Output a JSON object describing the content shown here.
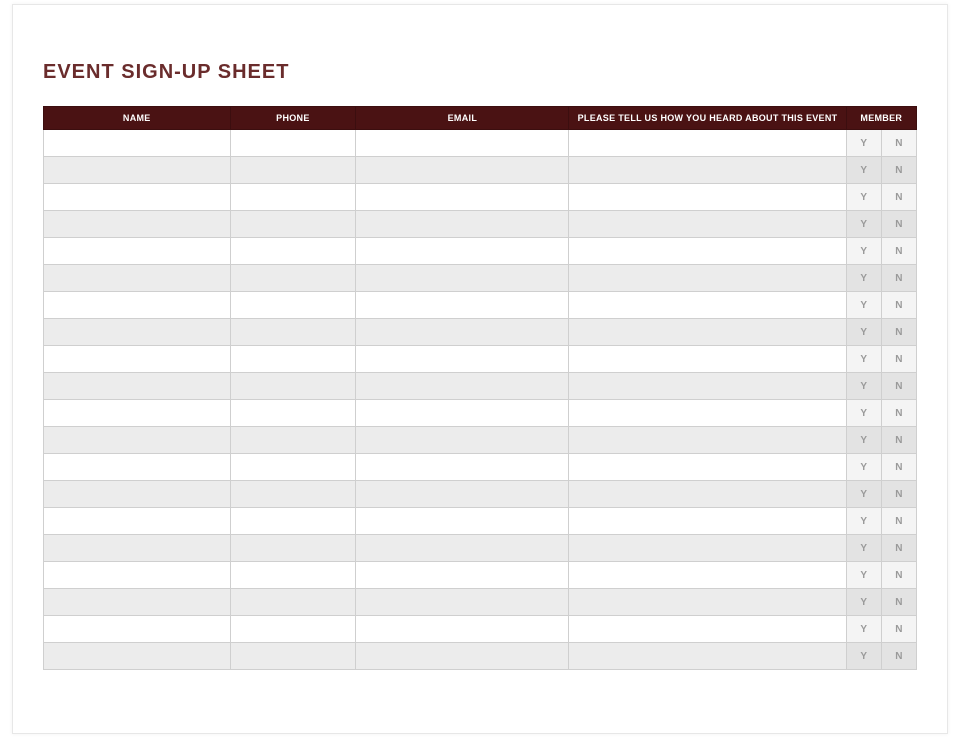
{
  "title": "EVENT SIGN-UP SHEET",
  "columns": {
    "name": "NAME",
    "phone": "PHONE",
    "email": "EMAIL",
    "heard": "PLEASE TELL US HOW YOU HEARD ABOUT THIS EVENT",
    "member": "MEMBER"
  },
  "member_options": {
    "yes": "Y",
    "no": "N"
  },
  "row_count": 20
}
